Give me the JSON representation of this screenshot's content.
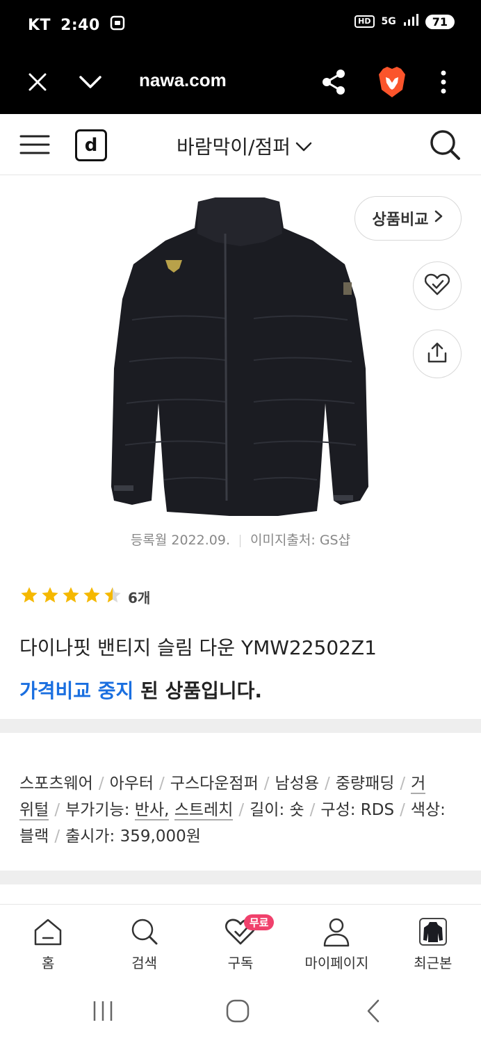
{
  "status_bar": {
    "carrier": "KT",
    "time": "2:40",
    "network": "5G",
    "hd": "HD",
    "battery": "71"
  },
  "browser": {
    "url": "nawa.com"
  },
  "header": {
    "logo": "d",
    "category": "바람막이/점퍼"
  },
  "product": {
    "compare_label": "상품비교",
    "registered": "등록월 2022.09.",
    "image_source": "이미지출처: GS샵",
    "rating_value": 4.5,
    "review_count": "6개",
    "name": "다이나핏 밴티지 슬림 다운 YMW22502Z1",
    "status_highlight": "가격비교 중지",
    "status_rest": " 된 상품입니다."
  },
  "specs": {
    "line1": [
      "스포츠웨어",
      "아우터",
      "구스다운점퍼",
      "남성용",
      "중량패딩",
      "거"
    ],
    "line2_start": "위털",
    "extra_label": "부가기능:",
    "extra_1": "반사,",
    "extra_2": "스트레치",
    "length": "길이: 숏",
    "composition": "구성: RDS",
    "color_label": "색상:",
    "color_value": "블랙",
    "price": "출시가: 359,000원"
  },
  "bottom_nav": {
    "home": "홈",
    "search": "검색",
    "subscribe": "구독",
    "free_badge": "무료",
    "mypage": "마이페이지",
    "recent": "최근본"
  },
  "colors": {
    "accent_blue": "#1a6fe0",
    "star": "#f5b800",
    "badge_pink": "#f0416c"
  }
}
